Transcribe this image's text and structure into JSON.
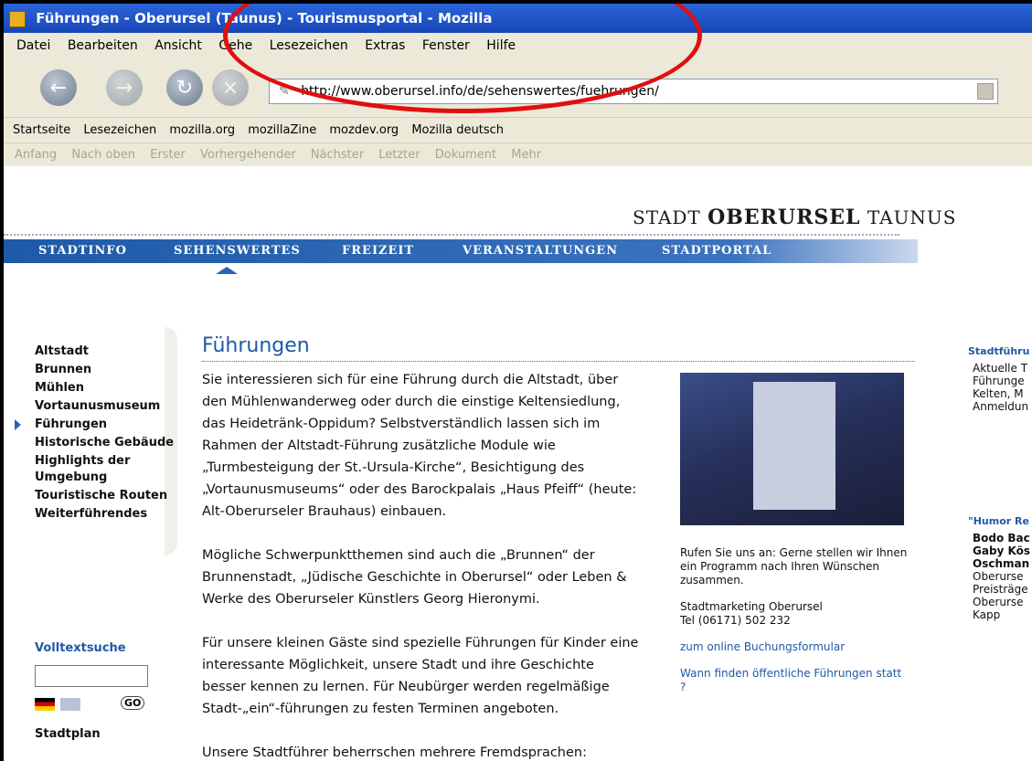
{
  "window": {
    "title": "Führungen - Oberursel (Taunus) - Tourismusportal - Mozilla"
  },
  "menu": [
    "Datei",
    "Bearbeiten",
    "Ansicht",
    "Gehe",
    "Lesezeichen",
    "Extras",
    "Fenster",
    "Hilfe"
  ],
  "address": {
    "url": "http://www.oberursel.info/de/sehenswertes/fuehrungen/"
  },
  "bookmarks": [
    "Startseite",
    "Lesezeichen",
    "mozilla.org",
    "mozillaZine",
    "mozdev.org",
    "Mozilla deutsch"
  ],
  "sitenav": [
    "Anfang",
    "Nach oben",
    "Erster",
    "Vorhergehender",
    "Nächster",
    "Letzter",
    "Dokument",
    "Mehr"
  ],
  "logo": {
    "pre": "STADT",
    "name": "OBERURSEL",
    "post": "TAUNUS"
  },
  "mainnav": [
    "STADTINFO",
    "SEHENSWERTES",
    "FREIZEIT",
    "VERANSTALTUNGEN",
    "STADTPORTAL"
  ],
  "leftnav": [
    "Altstadt",
    "Brunnen",
    "Mühlen",
    "Vortaunusmuseum",
    "Führungen",
    "Historische Gebäude",
    "Highlights der Umgebung",
    "Touristische Routen",
    "Weiterführendes"
  ],
  "search": {
    "title": "Volltextsuche",
    "go": "GO",
    "map": "Stadtplan"
  },
  "content": {
    "title": "Führungen",
    "p1": "Sie interessieren sich für eine Führung durch die Altstadt, über den Mühlenwanderweg oder durch die einstige Keltensiedlung, das Heidetränk-Oppidum? Selbstverständlich lassen sich im Rahmen der Altstadt-Führung zusätzliche Module wie „Turmbesteigung der St.-Ursula-Kirche“, Besichtigung des „Vortaunusmuseums“ oder des Barockpalais „Haus Pfeiff“ (heute: Alt-Oberurseler Brauhaus) einbauen.",
    "p2": "Mögliche Schwerpunktthemen sind auch die „Brunnen“ der Brunnenstadt, „Jüdische Geschichte in Oberursel“ oder Leben & Werke des Oberurseler Künstlers Georg Hieronymi.",
    "p3": "Für unsere kleinen Gäste sind spezielle Führungen für Kinder eine interessante Möglichkeit, unsere Stadt und ihre Geschichte besser kennen zu lernen. Für Neubürger werden regelmäßige Stadt-„ein“-führungen zu festen Terminen angeboten.",
    "p4": "Unsere Stadtführer beherrschen mehrere Fremdsprachen:"
  },
  "side": {
    "call": "Rufen Sie uns an: Gerne stellen wir Ihnen ein Programm nach Ihren Wünschen zusammen.",
    "contact1": "Stadtmarketing Oberursel",
    "contact2": "Tel (06171) 502 232",
    "link1": "zum online Buchungsformular",
    "link2": "Wann finden öffentliche Führungen statt ?"
  },
  "right": {
    "title1": "Stadtführu",
    "lines1": [
      "Aktuelle T",
      "Führunge",
      "Kelten, M",
      "Anmeldun"
    ],
    "title2": "\"Humor Re",
    "bold2": [
      "Bodo Bac",
      "Gaby Kös",
      "Oschman"
    ],
    "lines2": [
      "Oberurse",
      "Preisträge",
      "Oberurse",
      "Kapp"
    ]
  }
}
